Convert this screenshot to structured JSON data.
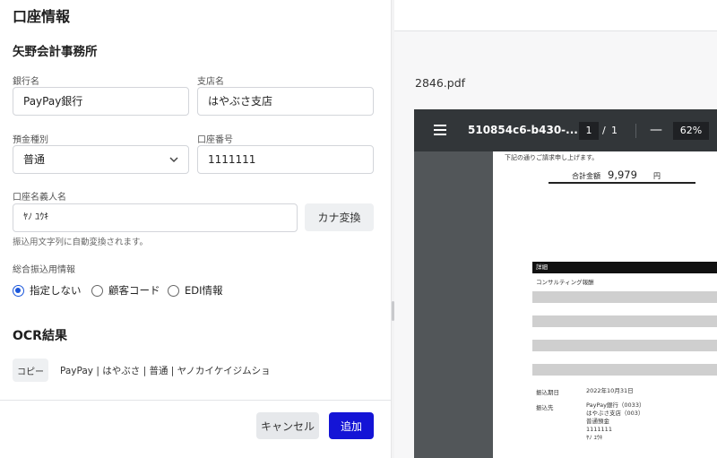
{
  "form": {
    "title": "口座情報",
    "section_name": "矢野会計事務所",
    "bank_name": {
      "label": "銀行名",
      "value": "PayPay銀行"
    },
    "branch_name": {
      "label": "支店名",
      "value": "はやぶさ支店"
    },
    "deposit_type": {
      "label": "預金種別",
      "value": "普通"
    },
    "account_number": {
      "label": "口座番号",
      "value": "1111111"
    },
    "holder_name": {
      "label": "口座名義人名",
      "value": "ﾔﾉ ﾕｳｷ",
      "kana_button": "カナ変換",
      "helper": "振込用文字列に自動変換されます。"
    },
    "transfer_info": {
      "label": "総合振込用情報",
      "options": [
        {
          "label": "指定しない",
          "selected": true
        },
        {
          "label": "顧客コード",
          "selected": false
        },
        {
          "label": "EDI情報",
          "selected": false
        }
      ]
    },
    "ocr": {
      "title": "OCR結果",
      "copy_button": "コピー",
      "text": "PayPay | はやぶさ | 普通 | ヤノカイケイジムショ"
    },
    "cancel_button": "キャンセル",
    "add_button": "追加"
  },
  "preview": {
    "file_name": "2846.pdf",
    "viewer": {
      "doc_title": "510854c6-b430-...",
      "page_current": "1",
      "page_separator": "/",
      "page_total": "1",
      "zoom_out": "—",
      "zoom": "62%"
    },
    "document": {
      "greeting": "下記の通りご請求申し上げます。",
      "total_label": "合計金額",
      "total_value": "9,979",
      "total_unit": "円",
      "detail_header": "詳細",
      "detail_item": "コンサルティング報酬",
      "due_label": "振込期日",
      "due_value": "2022年10月31日",
      "payee_label": "振込先",
      "payee_lines": [
        "PayPay銀行（0033）",
        "はやぶさ支店（003）",
        "普通預金",
        "1111111",
        "ﾔﾉ ﾕｳｷ"
      ]
    }
  },
  "colors": {
    "primary": "#1414d6",
    "radio": "#1a56db",
    "viewer_bg": "#525659",
    "viewer_bar": "#323639"
  }
}
